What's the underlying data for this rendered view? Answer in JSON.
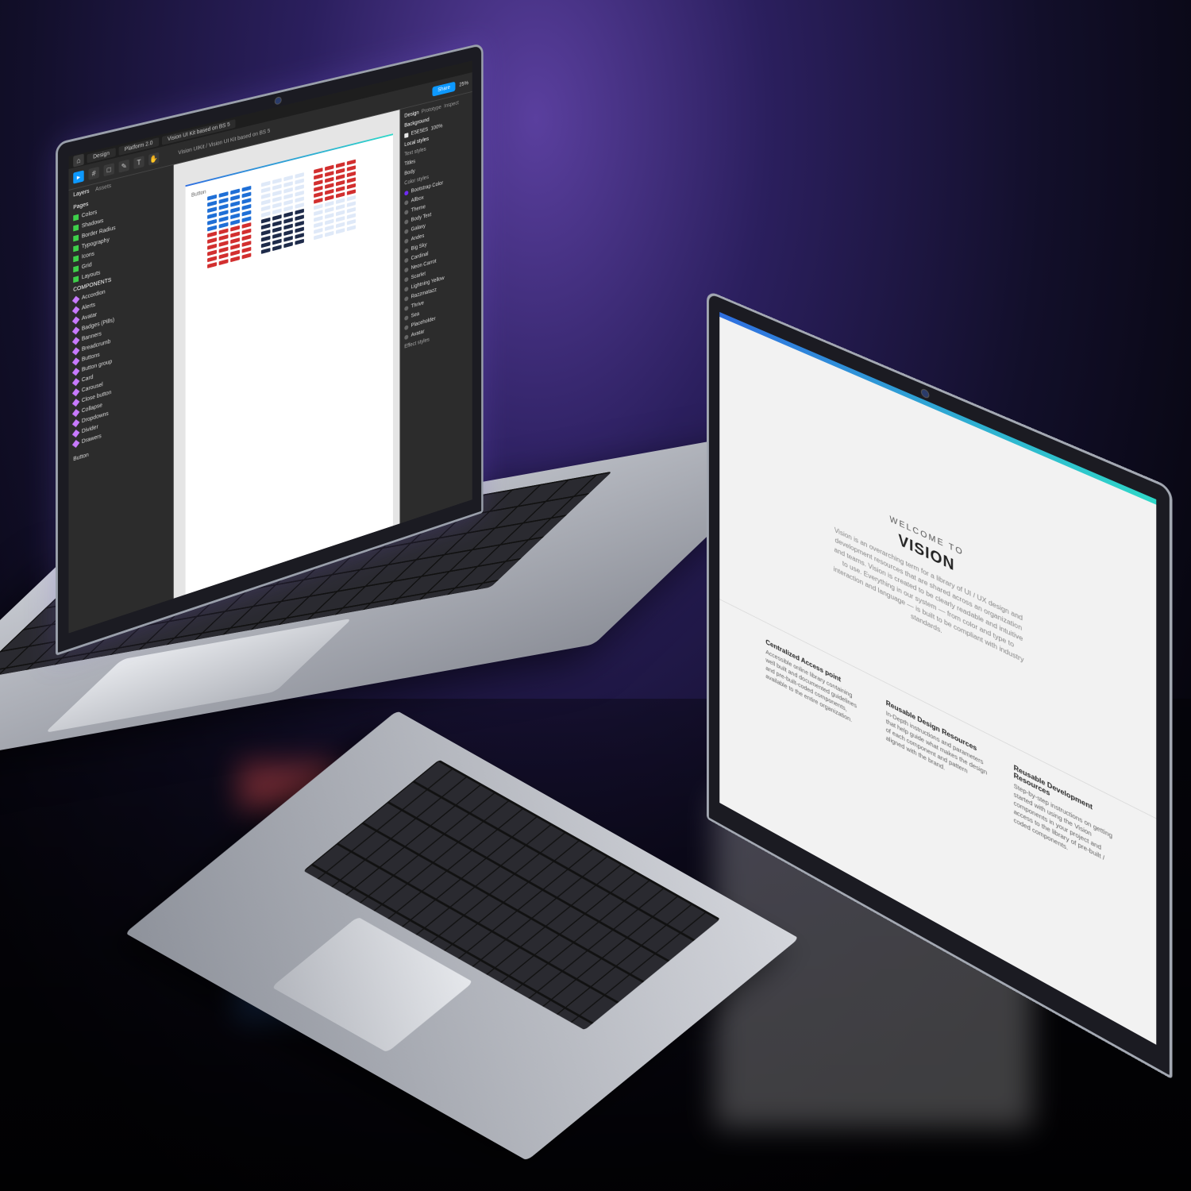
{
  "figma": {
    "tabs": [
      "Design",
      "Platform 2.0",
      "Vision UI Kit based on BS 5"
    ],
    "file_title": "Vision UIKit / Vision UI Kit based on BS 5",
    "share_label": "Share",
    "zoom": "25%",
    "left_panel_tabs": [
      "Layers",
      "Assets"
    ],
    "pages_label": "Pages",
    "layers": [
      "Colors",
      "Shadows",
      "Border Radius",
      "Typography",
      "Icons",
      "Grid",
      "Layouts"
    ],
    "components_label": "COMPONENTS",
    "components": [
      "Accordion",
      "Alerts",
      "Avatar",
      "Badges (Pills)",
      "Banners",
      "Breadcrumb",
      "Buttons",
      "Button group",
      "Card",
      "Carousel",
      "Close button",
      "Collapse",
      "Dropdowns",
      "Divider",
      "Drawers"
    ],
    "bottom_layer": "Button",
    "right_panel_tabs": [
      "Design",
      "Prototype",
      "Inspect"
    ],
    "background_label": "Background",
    "background_hex": "E5E5E5",
    "background_opacity": "100%",
    "local_styles": "Local styles",
    "text_styles_label": "Text styles",
    "text_styles": [
      "Titles",
      "Body"
    ],
    "color_styles_label": "Color styles",
    "color_styles": [
      "Bootstrap Color",
      "Allbox",
      "Theme",
      "Body Text",
      "Galaxy",
      "Andes",
      "Big Sky",
      "Cardinal",
      "Neon Carrot",
      "Scarlet",
      "Lightning Yellow",
      "Razzmatazz",
      "Thrive",
      "Sea",
      "Placeholder",
      "Avatar"
    ],
    "effect_styles": "Effect styles",
    "canvas_frame_label": "Button"
  },
  "vision_site": {
    "welcome": "WELCOME TO",
    "title": "VISION",
    "intro": "Vision is an overarching term for a library of UI / UX design and development resources that are shared across an organization and teams. Vision is created to be clearly readable and intuitive to use. Everything in our system — from color and type to interaction and language — is built to be compliant with industry standards.",
    "features": [
      {
        "title": "Centralized Access point",
        "text": "Accessible online library containing well built and documented guidelines and pre-built-coded components, available to the entire organization."
      },
      {
        "title": "Reusable Design Resources",
        "text": "In-Depth instructions and parameters that help guide what makes the design of each component and pattern aligned with the brand."
      },
      {
        "title": "Reusable Development Resources",
        "text": "Step-by-step instructions on getting started with using the Vision components in your project and access to the library of pre-built / coded components."
      }
    ]
  },
  "colors": {
    "figma_blue": "#0d99ff",
    "gradient_start": "#2f6fe0",
    "gradient_end": "#2fd8c8",
    "btn_blue": "#1f6fd6",
    "btn_red": "#d22f2f",
    "btn_navy": "#1e2b4a",
    "btn_light": "#dfe9f8"
  }
}
